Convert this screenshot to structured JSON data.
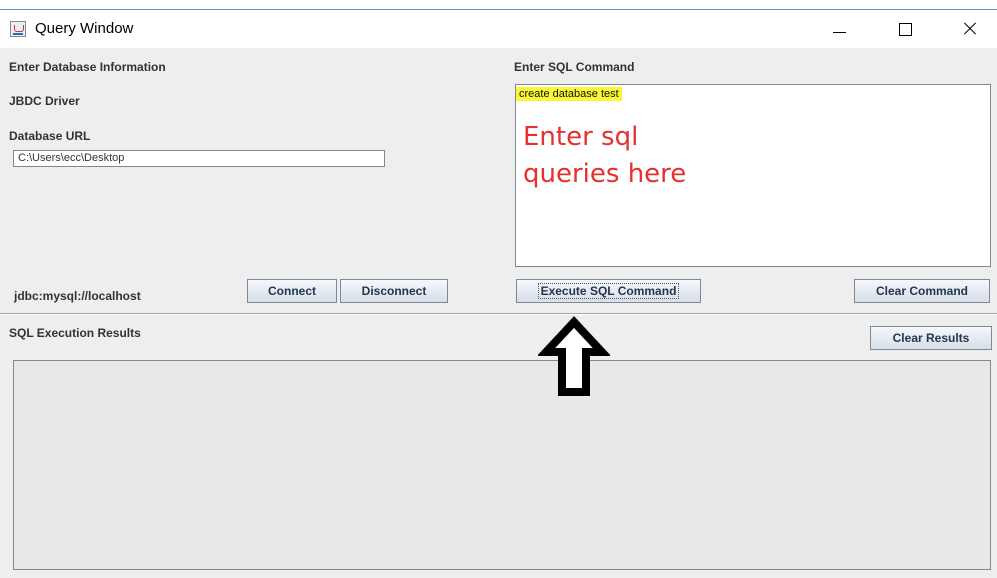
{
  "window": {
    "title": "Query Window"
  },
  "left_panel": {
    "section_title": "Enter Database Information",
    "driver_label": "JBDC Driver",
    "url_label": "Database URL",
    "url_value": "C:\\Users\\ecc\\Desktop",
    "connection_status": "jdbc:mysql://localhost",
    "connect_label": "Connect",
    "disconnect_label": "Disconnect"
  },
  "sql_panel": {
    "title": "Enter SQL Command",
    "command_text": "create database test",
    "annotation": "Enter sql\nqueries here",
    "execute_label": "Execute SQL Command",
    "clear_label": "Clear Command"
  },
  "results_panel": {
    "title": "SQL Execution Results",
    "clear_label": "Clear Results"
  },
  "colors": {
    "highlight": "#fbf736",
    "annotation": "#e53030",
    "arrow": "#000000"
  },
  "icons": [
    "java-app-icon",
    "minimize-icon",
    "maximize-icon",
    "close-icon",
    "up-arrow-icon"
  ]
}
